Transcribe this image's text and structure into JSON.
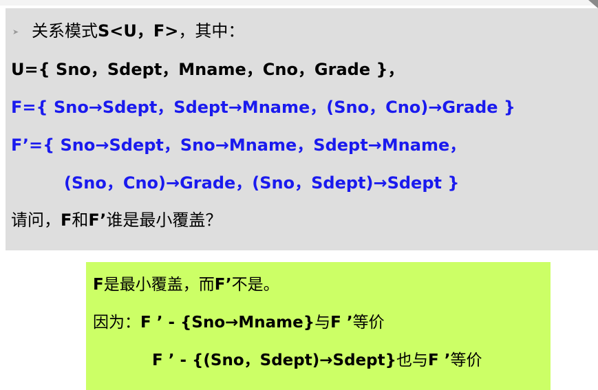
{
  "question": {
    "bullet_icon": "triangle-bullet",
    "intro_prefix": "关系模式",
    "intro_schema": "S<U，F>",
    "intro_suffix": "，其中：",
    "u_def": "U={ Sno，Sdept，Mname，Cno，Grade }，",
    "f_def": "F={ Sno→Sdept，Sdept→Mname，(Sno，Cno)→Grade }",
    "fprime_def_line1": "F’={ Sno→Sdept，Sno→Mname，Sdept→Mname，",
    "fprime_def_line2": "(Sno，Cno)→Grade，(Sno，Sdept)→Sdept   }",
    "ask_prefix": "请问，",
    "ask_f": "F",
    "ask_and": "和",
    "ask_fprime": "F’",
    "ask_suffix": "谁是最小覆盖？"
  },
  "answer": {
    "line1_f": "F",
    "line1_mid": "是最小覆盖，而",
    "line1_fprime": "F’",
    "line1_end": "不是。",
    "line2_prefix": "因为：",
    "line2_expr": "F ’ - {Sno→Mname}",
    "line2_mid": "与",
    "line2_f": "F ’",
    "line2_end": "等价",
    "line3_expr": "F ’ - {(Sno，Sdept)→Sdept}",
    "line3_mid": "也与",
    "line3_f": "F ’",
    "line3_end": "等价"
  },
  "colors": {
    "question_background": "#dedede",
    "answer_background": "#ccff66",
    "highlight_text": "#1a1aee"
  }
}
